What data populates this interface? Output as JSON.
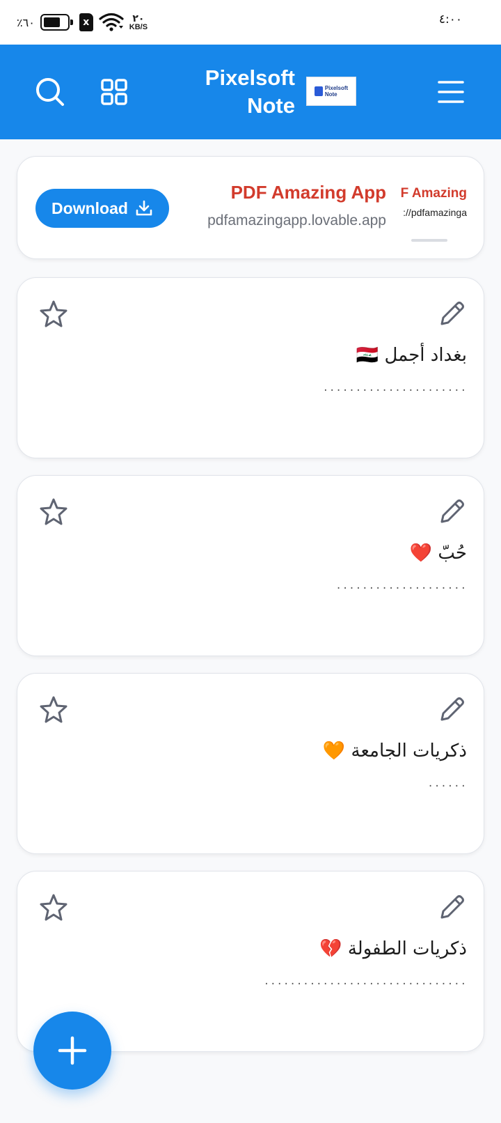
{
  "status_bar": {
    "battery_percent": "٪٦٠",
    "battery_level": 0.6,
    "sim_label": "x",
    "speed_value": "٢٠",
    "speed_unit": "KB/S",
    "time": "٤:٠٠"
  },
  "app_bar": {
    "title_line1": "Pixelsoft",
    "title_line2": "Note",
    "logo_text_line1": "Pixelsoft",
    "logo_text_line2": "Note",
    "icons": [
      "search-icon",
      "grid-icon",
      "menu-icon"
    ]
  },
  "ad": {
    "button_label": "Download",
    "title": "PDF Amazing App",
    "url": "pdfamazingapp.lovable.app",
    "thumb_title": "F Amazing",
    "thumb_url": "://pdfamazinga"
  },
  "notes": [
    {
      "title": "بغداد أجمل 🇮🇶",
      "preview": "......................"
    },
    {
      "title": "حُبّ ❤️",
      "preview": "...................."
    },
    {
      "title": "ذكريات الجامعة 🧡",
      "preview": "......"
    },
    {
      "title": "ذكريات الطفولة 💔",
      "preview": "..............................."
    }
  ],
  "colors": {
    "primary": "#1787ea",
    "ad_title": "#d23b2c",
    "icon_gray": "#5f6472"
  }
}
